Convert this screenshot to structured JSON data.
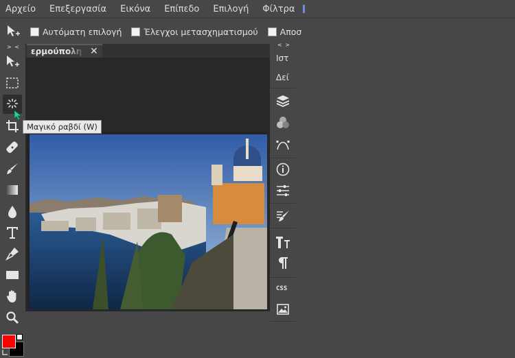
{
  "menubar": {
    "items": [
      "Αρχείο",
      "Επεξεργασία",
      "Εικόνα",
      "Επίπεδο",
      "Επιλογή",
      "Φίλτρα"
    ]
  },
  "options": {
    "auto_select": "Αυτόματη επιλογή",
    "transform_controls": "Έλεγχοι μετασχηματισμού",
    "truncated": "Αποσ"
  },
  "panels": {
    "left_collapse": "> <",
    "right_collapse": "< >"
  },
  "document": {
    "tab_title": "ερμούπολη",
    "close_symbol": "✕"
  },
  "tooltip": {
    "text": "Μαγικό ραβδί (W)"
  },
  "right_panel": {
    "history_label": "Ιστ",
    "swatches_label": "Δεί",
    "css_label": "CSS"
  },
  "colors": {
    "foreground": "#ff0000",
    "background": "#000000",
    "accent": "#2ecc9a"
  },
  "icons": {
    "toolbar": [
      "move-icon",
      "marquee-icon",
      "magic-wand-icon",
      "crop-icon",
      "healing-icon",
      "brush-icon",
      "gradient-icon",
      "blur-icon",
      "text-icon",
      "pen-icon",
      "shape-icon",
      "hand-icon",
      "zoom-icon"
    ],
    "right": [
      "layers-icon",
      "channels-icon",
      "paths-icon",
      "info-icon",
      "adjustments-icon",
      "brushes-icon",
      "character-icon",
      "paragraph-icon",
      "css-icon",
      "image-icon"
    ]
  }
}
